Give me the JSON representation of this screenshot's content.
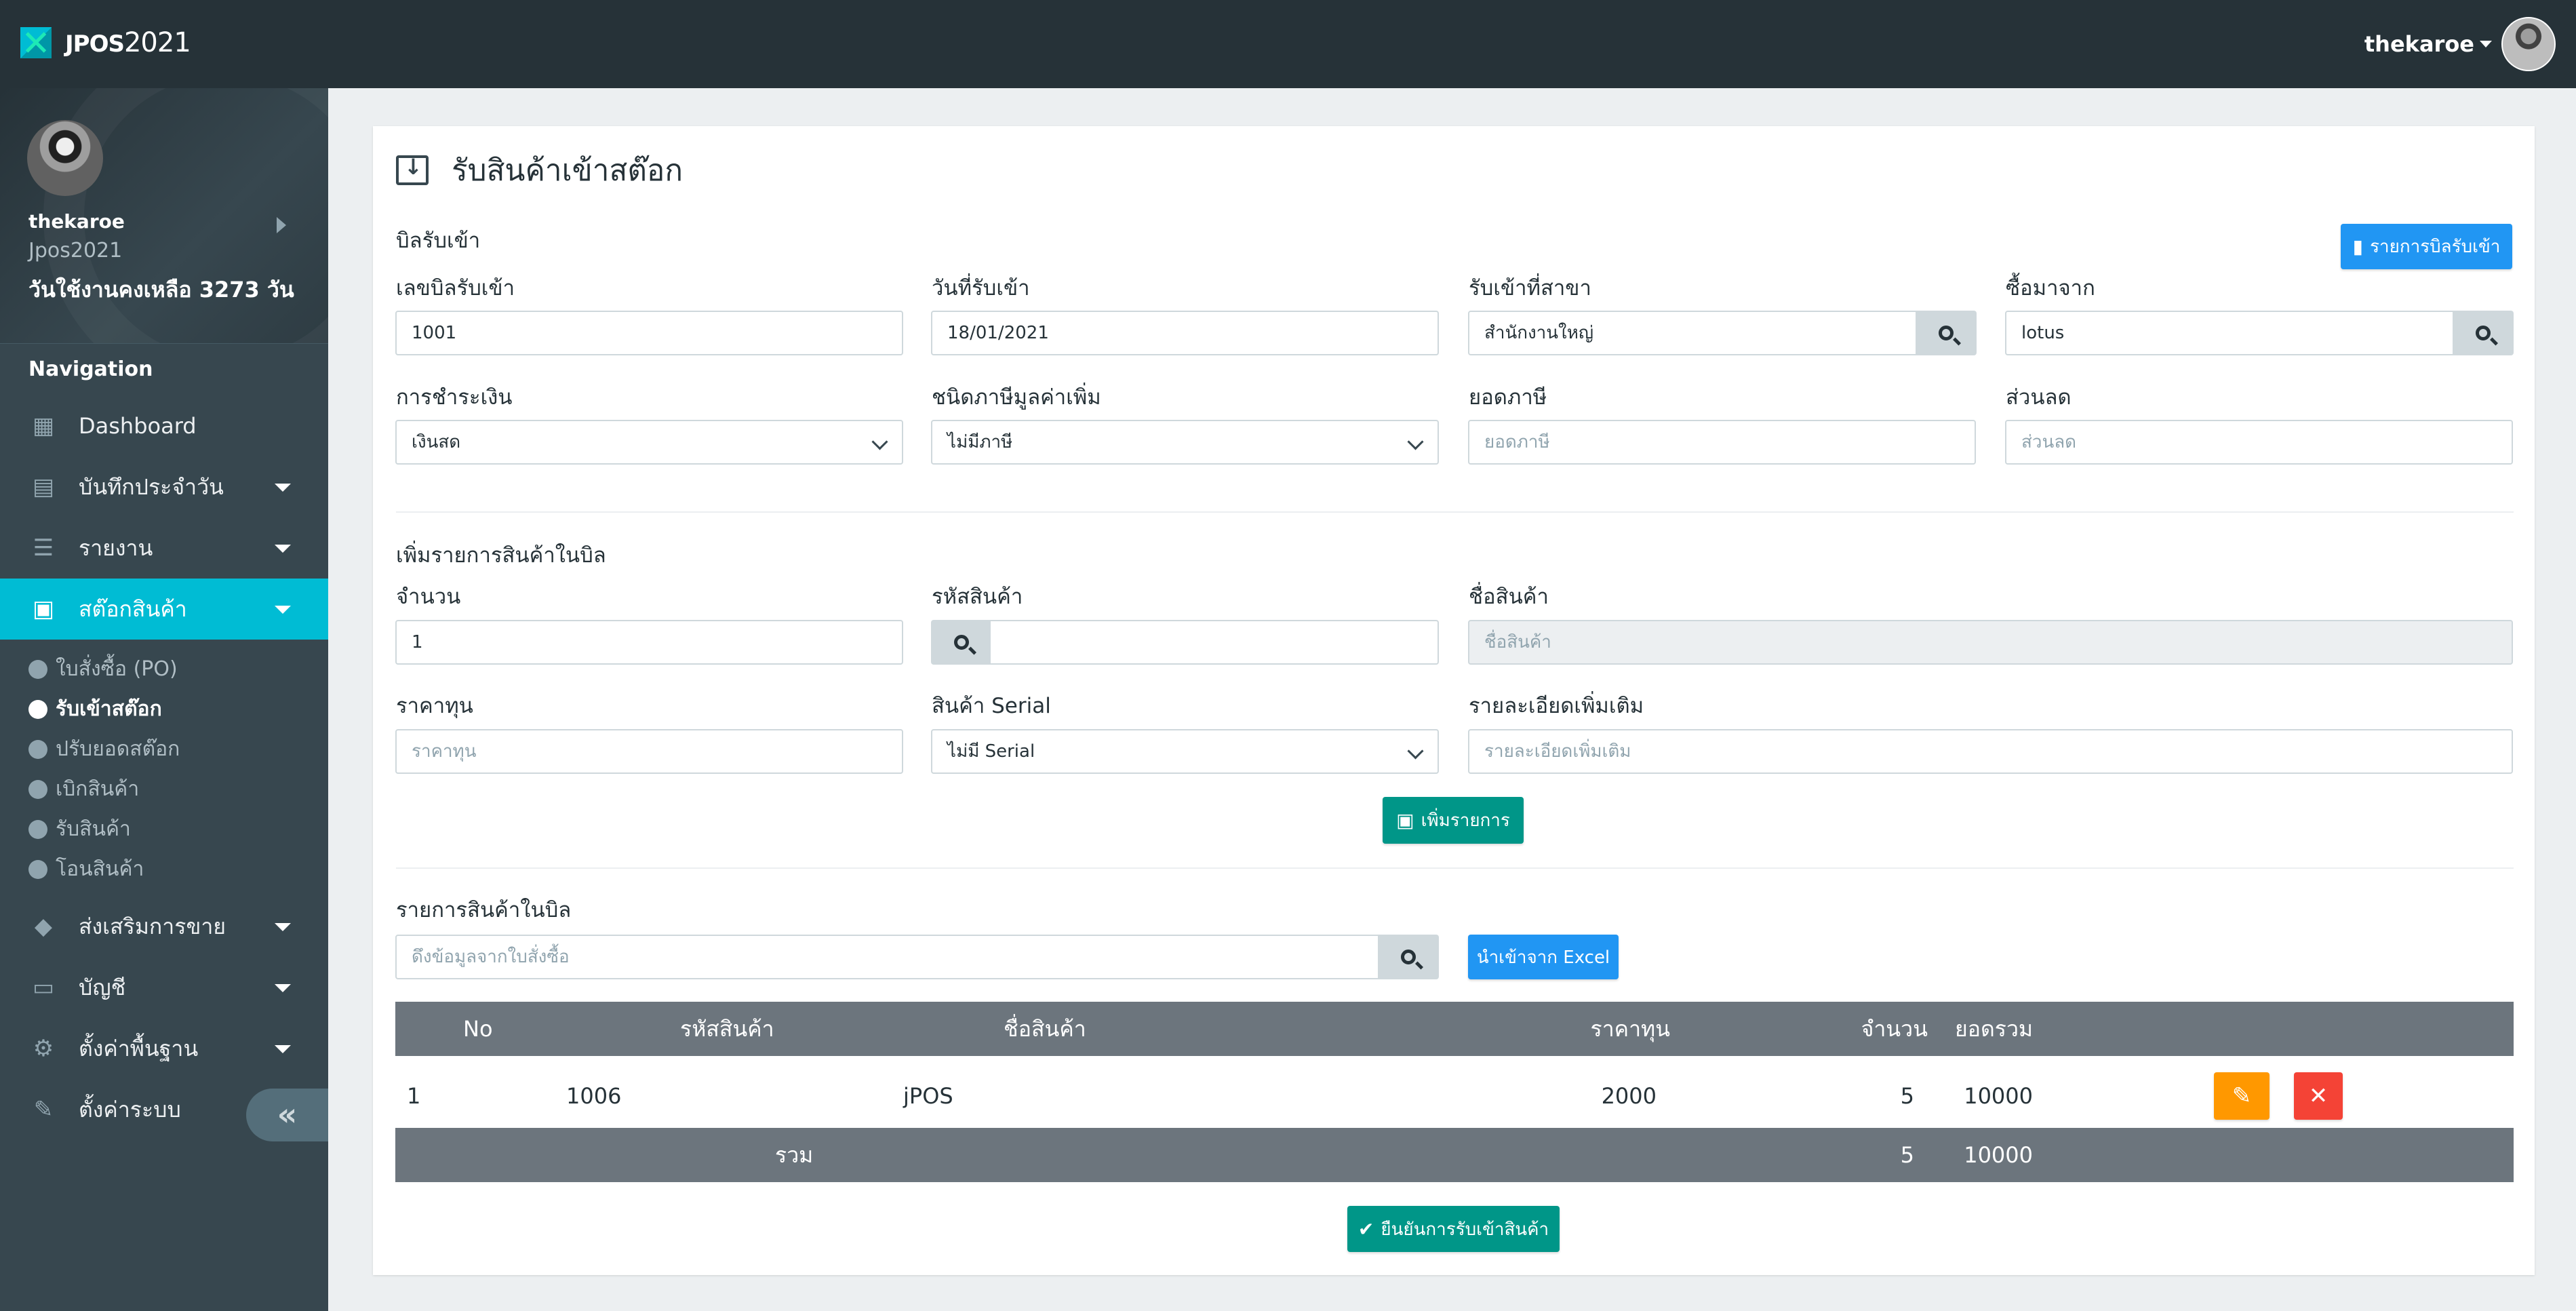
{
  "app": {
    "brand_bold": "JPOS",
    "brand_rest": "2021",
    "user": "thekaroe"
  },
  "profile": {
    "name": "thekaroe",
    "app": "Jpos2021",
    "days_left": "วันใช้งานคงเหลือ 3273 วัน"
  },
  "nav": {
    "title": "Navigation",
    "items": [
      {
        "label": "Dashboard",
        "icon": "chart-icon"
      },
      {
        "label": "บันทึกประจำวัน",
        "icon": "cash-register-icon"
      },
      {
        "label": "รายงาน",
        "icon": "report-icon"
      },
      {
        "label": "สต๊อกสินค้า",
        "icon": "stock-icon"
      },
      {
        "label": "ส่งเสริมการขาย",
        "icon": "tag-icon"
      },
      {
        "label": "บัญชี",
        "icon": "laptop-icon"
      },
      {
        "label": "ตั้งค่าพื้นฐาน",
        "icon": "gear-icon"
      },
      {
        "label": "ตั้งค่าระบบ",
        "icon": "wrench-icon"
      }
    ],
    "stock_sub": [
      "ใบสั่งซื้อ (PO)",
      "รับเข้าสต๊อก",
      "ปรับยอดสต๊อก",
      "เบิกสินค้า",
      "รับสินค้า",
      "โอนสินค้า"
    ],
    "collapse": "«"
  },
  "page": {
    "title": "รับสินค้าเข้าสต๊อก",
    "section_bill": "บิลรับเข้า",
    "bill_list_button": "รายการบิลรับเข้า"
  },
  "form": {
    "bill_no_label": "เลขบิลรับเข้า",
    "bill_no": "1001",
    "date_label": "วันที่รับเข้า",
    "date": "18/01/2021",
    "branch_label": "รับเข้าที่สาขา",
    "branch": "สำนักงานใหญ่",
    "supplier_label": "ซื้อมาจาก",
    "supplier": "lotus",
    "payment_label": "การชำระเงิน",
    "payment": "เงินสด",
    "vat_type_label": "ชนิดภาษีมูลค่าเพิ่ม",
    "vat_type": "ไม่มีภาษี",
    "vat_amount_label": "ยอดภาษี",
    "vat_amount_placeholder": "ยอดภาษี",
    "discount_label": "ส่วนลด",
    "discount_placeholder": "ส่วนลด"
  },
  "add_item": {
    "section": "เพิ่มรายการสินค้าในบิล",
    "qty_label": "จำนวน",
    "qty": "1",
    "code_label": "รหัสสินค้า",
    "name_label": "ชื่อสินค้า",
    "name_placeholder": "ชื่อสินค้า",
    "cost_label": "ราคาทุน",
    "cost_placeholder": "ราคาทุน",
    "serial_label": "สินค้า Serial",
    "serial": "ไม่มี Serial",
    "detail_label": "รายละเอียดเพิ่มเติม",
    "detail_placeholder": "รายละเอียดเพิ่มเติม",
    "add_button": "เพิ่มรายการ"
  },
  "items": {
    "section": "รายการสินค้าในบิล",
    "po_placeholder": "ดึงข้อมูลจากใบสั่งซื้อ",
    "excel_button": "นำเข้าจาก Excel",
    "columns": [
      "No",
      "รหัสสินค้า",
      "ชื่อสินค้า",
      "ราคาทุน",
      "จำนวน",
      "ยอดรวม"
    ],
    "rows": [
      {
        "no": "1",
        "code": "1006",
        "name": "jPOS",
        "cost": "2000",
        "qty": "5",
        "total": "10000"
      }
    ],
    "footer": {
      "label": "รวม",
      "qty": "5",
      "total": "10000"
    },
    "confirm_button": "ยืนยันการรับเข้าสินค้า"
  },
  "colors": {
    "topbar": "#263238",
    "sidebar": "#37474f",
    "accent": "#00bcd4",
    "primary": "#2196f3",
    "success": "#009688",
    "warning": "#ff9800",
    "danger": "#f44336",
    "table_header": "#6c757d"
  }
}
